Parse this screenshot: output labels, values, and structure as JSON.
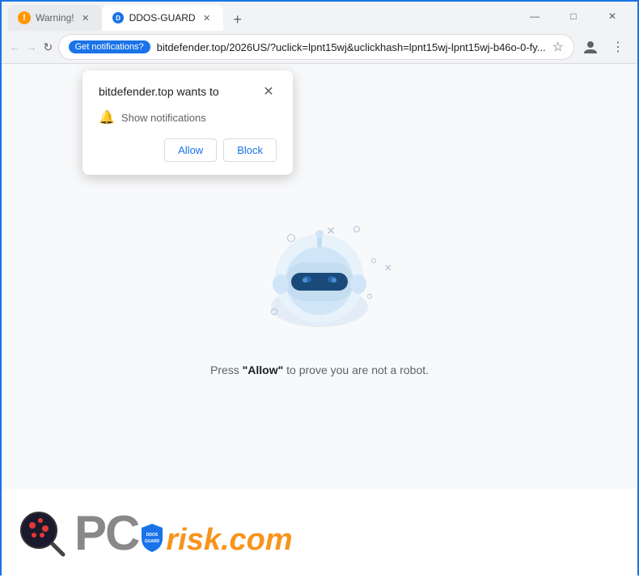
{
  "browser": {
    "tabs": [
      {
        "id": "tab-warning",
        "title": "Warning!",
        "favicon_type": "warning",
        "active": false
      },
      {
        "id": "tab-ddos",
        "title": "DDOS-GUARD",
        "favicon_type": "ddos",
        "active": true
      }
    ],
    "new_tab_label": "+",
    "window_controls": {
      "minimize": "—",
      "maximize": "□",
      "close": "✕"
    },
    "nav": {
      "back": "←",
      "forward": "→",
      "refresh": "↻"
    },
    "address_bar": {
      "notification_badge": "Get notifications?",
      "url": "bitdefender.top/2026US/?uclick=lpnt15wj&uclickhash=lpnt15wj-lpnt15wj-b46o-0-fy...",
      "star": "☆"
    },
    "toolbar": {
      "profile_icon": "👤",
      "menu_icon": "⋮"
    }
  },
  "popup": {
    "title": "bitdefender.top wants to",
    "close_icon": "✕",
    "notification_label": "Show notifications",
    "bell_icon": "🔔",
    "allow_button": "Allow",
    "block_button": "Block"
  },
  "page": {
    "caption_text": "Press ",
    "caption_bold": "\"Allow\"",
    "caption_suffix": " to prove you are not a robot."
  },
  "logo": {
    "pc_text": "PC",
    "risk_text": "risk",
    "dot_com": ".com",
    "shield_text": "DDOS\nGUARD"
  },
  "colors": {
    "browser_border": "#1a73e8",
    "tab_active_bg": "#ffffff",
    "tab_inactive_bg": "#e8eaed",
    "address_bar_bg": "#f1f3f4",
    "page_bg": "#f8f9fa",
    "popup_shadow": "rgba(0,0,0,0.2)",
    "allow_color": "#1a73e8",
    "block_color": "#1a73e8",
    "orange": "#f7941d",
    "gray": "#888888"
  }
}
